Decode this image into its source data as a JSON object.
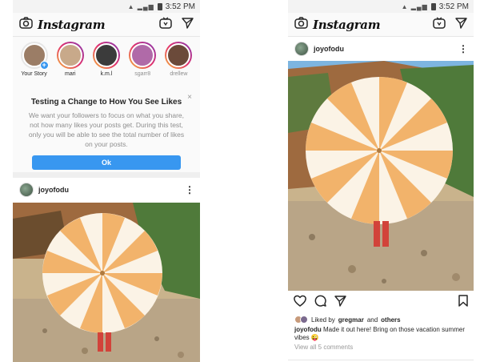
{
  "status": {
    "time": "3:52 PM"
  },
  "app": {
    "logo": "Instagram"
  },
  "left": {
    "stories": [
      {
        "name": "Your Story",
        "own": true,
        "color": "#9b7d66"
      },
      {
        "name": "mari",
        "own": false,
        "color": "#c8a98a"
      },
      {
        "name": "k.m.l",
        "own": false,
        "color": "#3b3b3b"
      },
      {
        "name": "sgarr8",
        "own": false,
        "color": "#b06aa8"
      },
      {
        "name": "drellew",
        "own": false,
        "color": "#6b4a3a"
      }
    ],
    "notice": {
      "title": "Testing a Change to How You See Likes",
      "body": "We want your followers to focus on what you share, not how many likes your posts get. During this test, only you will be able to see the total number of likes on your posts.",
      "button": "Ok",
      "close": "×"
    },
    "post": {
      "username": "joyofodu"
    }
  },
  "right": {
    "post": {
      "username": "joyofodu",
      "liked_by_prefix": "Liked by",
      "liked_by_user": "gregmar",
      "liked_by_and": "and",
      "liked_by_others": "others",
      "caption_user": "joyofodu",
      "caption_text": "Made it out here! Bring on those vacation summer vibes 😜",
      "view_comments": "View all 5 comments"
    }
  },
  "icons": {
    "camera": "camera-icon",
    "igtv": "igtv-icon",
    "direct": "paper-plane-icon",
    "more": "more-vertical-icon",
    "heart": "heart-icon",
    "comment": "comment-icon",
    "share": "share-icon",
    "bookmark": "bookmark-icon"
  },
  "colors": {
    "accent": "#3897f0",
    "umbrella_stripe": "#f2b36b",
    "sky": "#7db5e0"
  }
}
